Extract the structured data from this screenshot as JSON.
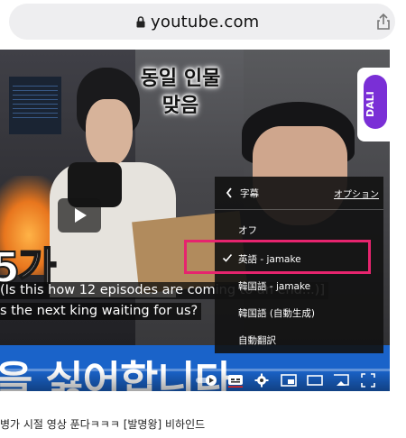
{
  "browser": {
    "url": "youtube.com"
  },
  "video": {
    "thumbnail_overlay_text": "동일 인물\n맞음",
    "thumbnail_big_text_top": "5가",
    "thumbnail_big_text_bottom": "을 싫어합니다",
    "channel_logo_text": "DALI",
    "captions": [
      "(Is this how 12 episodes are coming to an end...)]",
      "s the next king waiting for us?"
    ]
  },
  "subtitle_menu": {
    "title": "字幕",
    "options_link": "オプション",
    "items": [
      {
        "label": "オフ",
        "selected": false
      },
      {
        "label": "英語 - jamake",
        "selected": true
      },
      {
        "label": "韓国語 - jamake",
        "selected": false
      },
      {
        "label": "韓国語 (自動生成)",
        "selected": false
      },
      {
        "label": "自動翻訳",
        "selected": false
      }
    ]
  },
  "below_video": {
    "title": "병가 시절 영상 푼다ㅋㅋㅋ [발명왕] 비하인드"
  },
  "colors": {
    "highlight": "#e6246e",
    "thumbnail_blue": "#1a63c9",
    "logo_purple": "#7a2fd6"
  }
}
